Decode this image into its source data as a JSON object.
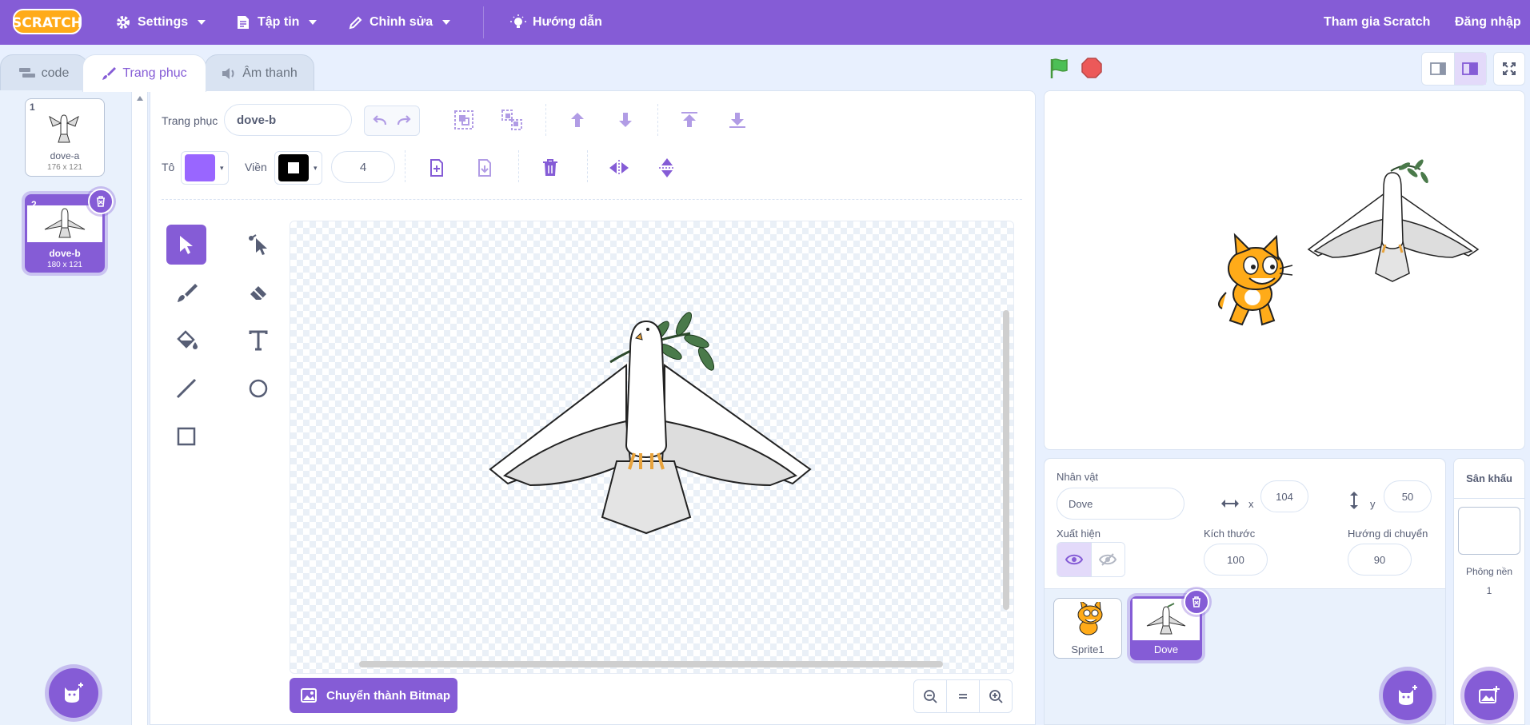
{
  "menubar": {
    "logo": "SCRATCH",
    "settings": "Settings",
    "file": "Tập tin",
    "edit": "Chỉnh sửa",
    "tutorials": "Hướng dẫn",
    "join": "Tham gia Scratch",
    "signin": "Đăng nhập"
  },
  "tabs": {
    "code": "code",
    "costumes": "Trang phục",
    "sounds": "Âm thanh"
  },
  "costumes": [
    {
      "num": "1",
      "name": "dove-a",
      "size": "176 x 121"
    },
    {
      "num": "2",
      "name": "dove-b",
      "size": "180 x 121"
    }
  ],
  "editor": {
    "costume_label": "Trang phục",
    "costume_name": "dove-b",
    "fill_label": "Tô",
    "outline_label": "Viền",
    "outline_width": "4",
    "convert_button": "Chuyển thành Bitmap",
    "fill_color": "#9966ff",
    "outline_color": "#000000"
  },
  "sprite_info": {
    "sprite_label": "Nhân vật",
    "sprite_name": "Dove",
    "x_label": "x",
    "x_value": "104",
    "y_label": "y",
    "y_value": "50",
    "show_label": "Xuất hiện",
    "size_label": "Kích thước",
    "size_value": "100",
    "direction_label": "Hướng di chuyển",
    "direction_value": "90"
  },
  "sprites": [
    {
      "name": "Sprite1"
    },
    {
      "name": "Dove"
    }
  ],
  "stage_panel": {
    "title": "Sân khấu",
    "backdrops_label": "Phông nền",
    "backdrops_count": "1"
  },
  "colors": {
    "accent": "#855cd6",
    "background": "#e8f0fe",
    "go_flag": "#4cbf56",
    "stop": "#ec5959"
  }
}
